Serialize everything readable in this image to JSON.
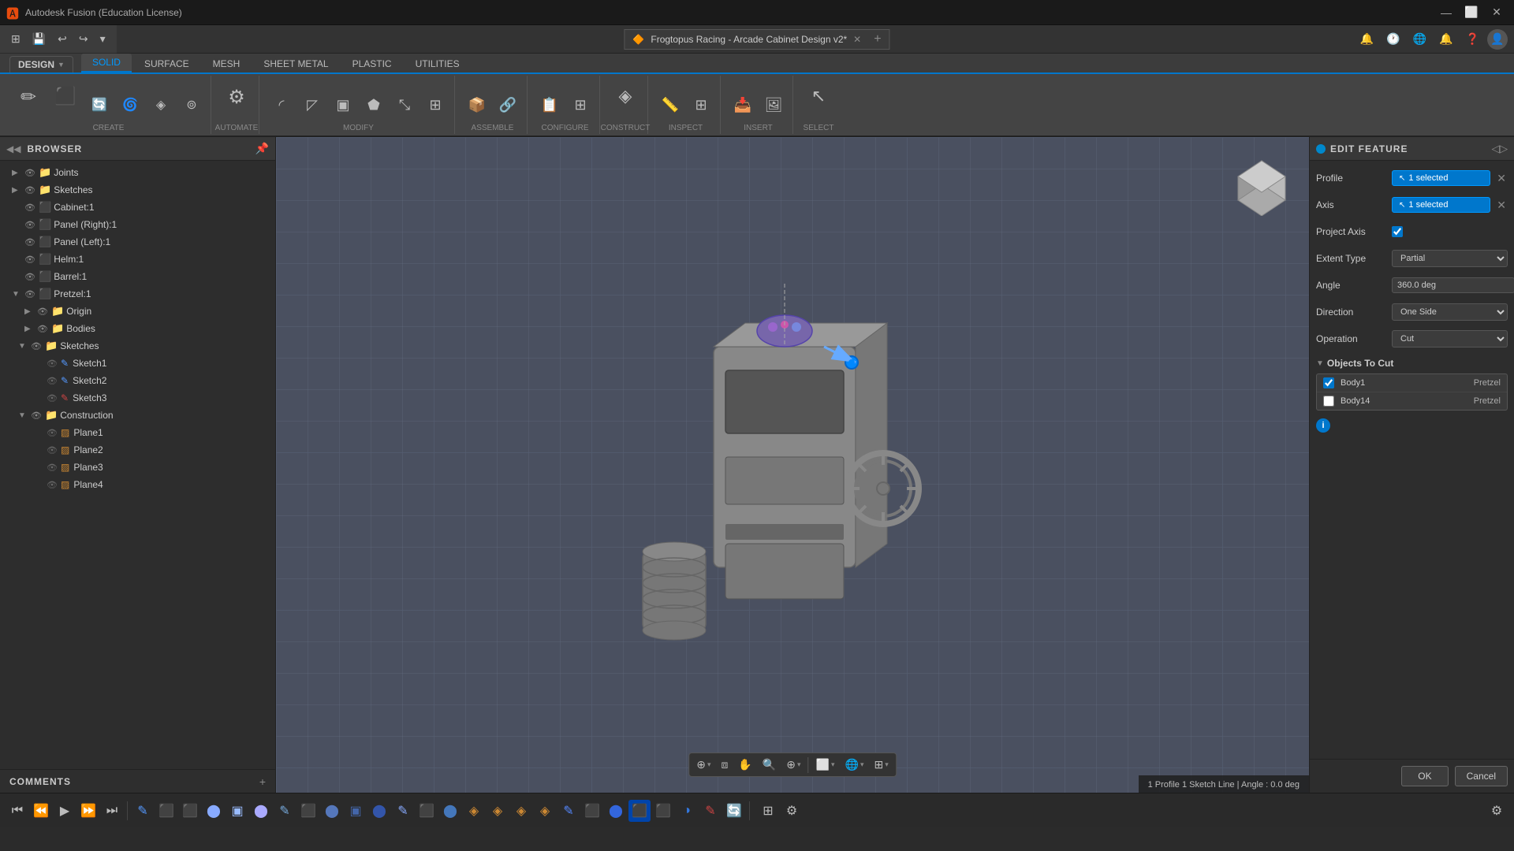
{
  "app": {
    "title": "Autodesk Fusion (Education License)",
    "icon": "🅰"
  },
  "window_controls": {
    "minimize": "—",
    "maximize": "⬜",
    "close": "✕"
  },
  "file_tab": {
    "icon": "🟠",
    "title": "Frogtopus Racing - Arcade Cabinet Design v2*",
    "close": "✕"
  },
  "design_btn": {
    "label": "DESIGN",
    "arrow": "▼"
  },
  "ribbon_tabs": [
    {
      "id": "solid",
      "label": "SOLID",
      "active": true
    },
    {
      "id": "surface",
      "label": "SURFACE",
      "active": false
    },
    {
      "id": "mesh",
      "label": "MESH",
      "active": false
    },
    {
      "id": "sheet_metal",
      "label": "SHEET METAL",
      "active": false
    },
    {
      "id": "plastic",
      "label": "PLASTIC",
      "active": false
    },
    {
      "id": "utilities",
      "label": "UTILITIES",
      "active": false
    }
  ],
  "ribbon_groups": [
    {
      "id": "create",
      "label": "CREATE",
      "has_arrow": true
    },
    {
      "id": "automate",
      "label": "AUTOMATE",
      "has_arrow": true
    },
    {
      "id": "modify",
      "label": "MODIFY",
      "has_arrow": true
    },
    {
      "id": "assemble",
      "label": "ASSEMBLE",
      "has_arrow": true
    },
    {
      "id": "configure",
      "label": "CONFIGURE",
      "has_arrow": true
    },
    {
      "id": "construct",
      "label": "CONSTRUCT",
      "has_arrow": true
    },
    {
      "id": "inspect",
      "label": "INSPECT",
      "has_arrow": true
    },
    {
      "id": "insert",
      "label": "INSERT",
      "has_arrow": true
    },
    {
      "id": "select",
      "label": "SELECT",
      "has_arrow": true
    }
  ],
  "browser": {
    "title": "BROWSER",
    "items": [
      {
        "id": "joints",
        "label": "Joints",
        "level": 0,
        "has_children": true,
        "expanded": false,
        "type": "folder"
      },
      {
        "id": "sketches1",
        "label": "Sketches",
        "level": 0,
        "has_children": true,
        "expanded": false,
        "type": "folder"
      },
      {
        "id": "cabinet",
        "label": "Cabinet:1",
        "level": 0,
        "has_children": false,
        "expanded": false,
        "type": "body"
      },
      {
        "id": "panel_right",
        "label": "Panel (Right):1",
        "level": 0,
        "has_children": false,
        "expanded": false,
        "type": "body"
      },
      {
        "id": "panel_left",
        "label": "Panel (Left):1",
        "level": 0,
        "has_children": false,
        "expanded": false,
        "type": "body"
      },
      {
        "id": "helm",
        "label": "Helm:1",
        "level": 0,
        "has_children": false,
        "expanded": false,
        "type": "body"
      },
      {
        "id": "barrel",
        "label": "Barrel:1",
        "level": 0,
        "has_children": false,
        "expanded": false,
        "type": "body"
      },
      {
        "id": "pretzel",
        "label": "Pretzel:1",
        "level": 0,
        "has_children": false,
        "expanded": false,
        "type": "body"
      },
      {
        "id": "origin",
        "label": "Origin",
        "level": 1,
        "has_children": false,
        "expanded": false,
        "type": "folder"
      },
      {
        "id": "bodies",
        "label": "Bodies",
        "level": 1,
        "has_children": false,
        "expanded": false,
        "type": "folder"
      },
      {
        "id": "sketches2",
        "label": "Sketches",
        "level": 1,
        "has_children": true,
        "expanded": true,
        "type": "folder"
      },
      {
        "id": "sketch1",
        "label": "Sketch1",
        "level": 2,
        "has_children": false,
        "expanded": false,
        "type": "sketch"
      },
      {
        "id": "sketch2",
        "label": "Sketch2",
        "level": 2,
        "has_children": false,
        "expanded": false,
        "type": "sketch"
      },
      {
        "id": "sketch3",
        "label": "Sketch3",
        "level": 2,
        "has_children": false,
        "expanded": false,
        "type": "sketch"
      },
      {
        "id": "construction",
        "label": "Construction",
        "level": 1,
        "has_children": true,
        "expanded": true,
        "type": "folder"
      },
      {
        "id": "plane1",
        "label": "Plane1",
        "level": 2,
        "has_children": false,
        "expanded": false,
        "type": "plane"
      },
      {
        "id": "plane2",
        "label": "Plane2",
        "level": 2,
        "has_children": false,
        "expanded": false,
        "type": "plane"
      },
      {
        "id": "plane3",
        "label": "Plane3",
        "level": 2,
        "has_children": false,
        "expanded": false,
        "type": "plane"
      },
      {
        "id": "plane4",
        "label": "Plane4",
        "level": 2,
        "has_children": false,
        "expanded": false,
        "type": "plane"
      }
    ]
  },
  "edit_feature": {
    "title": "EDIT FEATURE",
    "fields": {
      "profile_label": "Profile",
      "profile_value": "1 selected",
      "axis_label": "Axis",
      "axis_value": "1 selected",
      "project_axis_label": "Project Axis",
      "extent_type_label": "Extent Type",
      "extent_type_value": "Partial",
      "angle_label": "Angle",
      "angle_value": "360.0 deg",
      "direction_label": "Direction",
      "direction_value": "One Side",
      "operation_label": "Operation",
      "operation_value": "Cut"
    },
    "objects_to_cut": {
      "title": "Objects To Cut",
      "rows": [
        {
          "id": "body1",
          "name": "Body1",
          "type": "Pretzel",
          "checked": true
        },
        {
          "id": "body14",
          "name": "Body14",
          "type": "Pretzel",
          "checked": false
        }
      ]
    },
    "ok_label": "OK",
    "cancel_label": "Cancel"
  },
  "status_bar": {
    "text": "1 Profile 1 Sketch Line | Angle : 0.0 deg"
  },
  "comments": {
    "label": "COMMENTS"
  },
  "viewport_tools": [
    {
      "id": "fit",
      "icon": "⊕"
    },
    {
      "id": "orbit",
      "icon": "⟳"
    },
    {
      "id": "pan",
      "icon": "✋"
    },
    {
      "id": "zoom_extent",
      "icon": "🔍"
    },
    {
      "id": "zoom",
      "icon": "⊕"
    },
    {
      "id": "display",
      "icon": "⬜"
    },
    {
      "id": "render",
      "icon": "🌐"
    },
    {
      "id": "grid",
      "icon": "⊞"
    }
  ],
  "playback": {
    "rewind": "⏮",
    "prev": "⏪",
    "play": "▶",
    "next": "⏩",
    "end": "⏭"
  }
}
